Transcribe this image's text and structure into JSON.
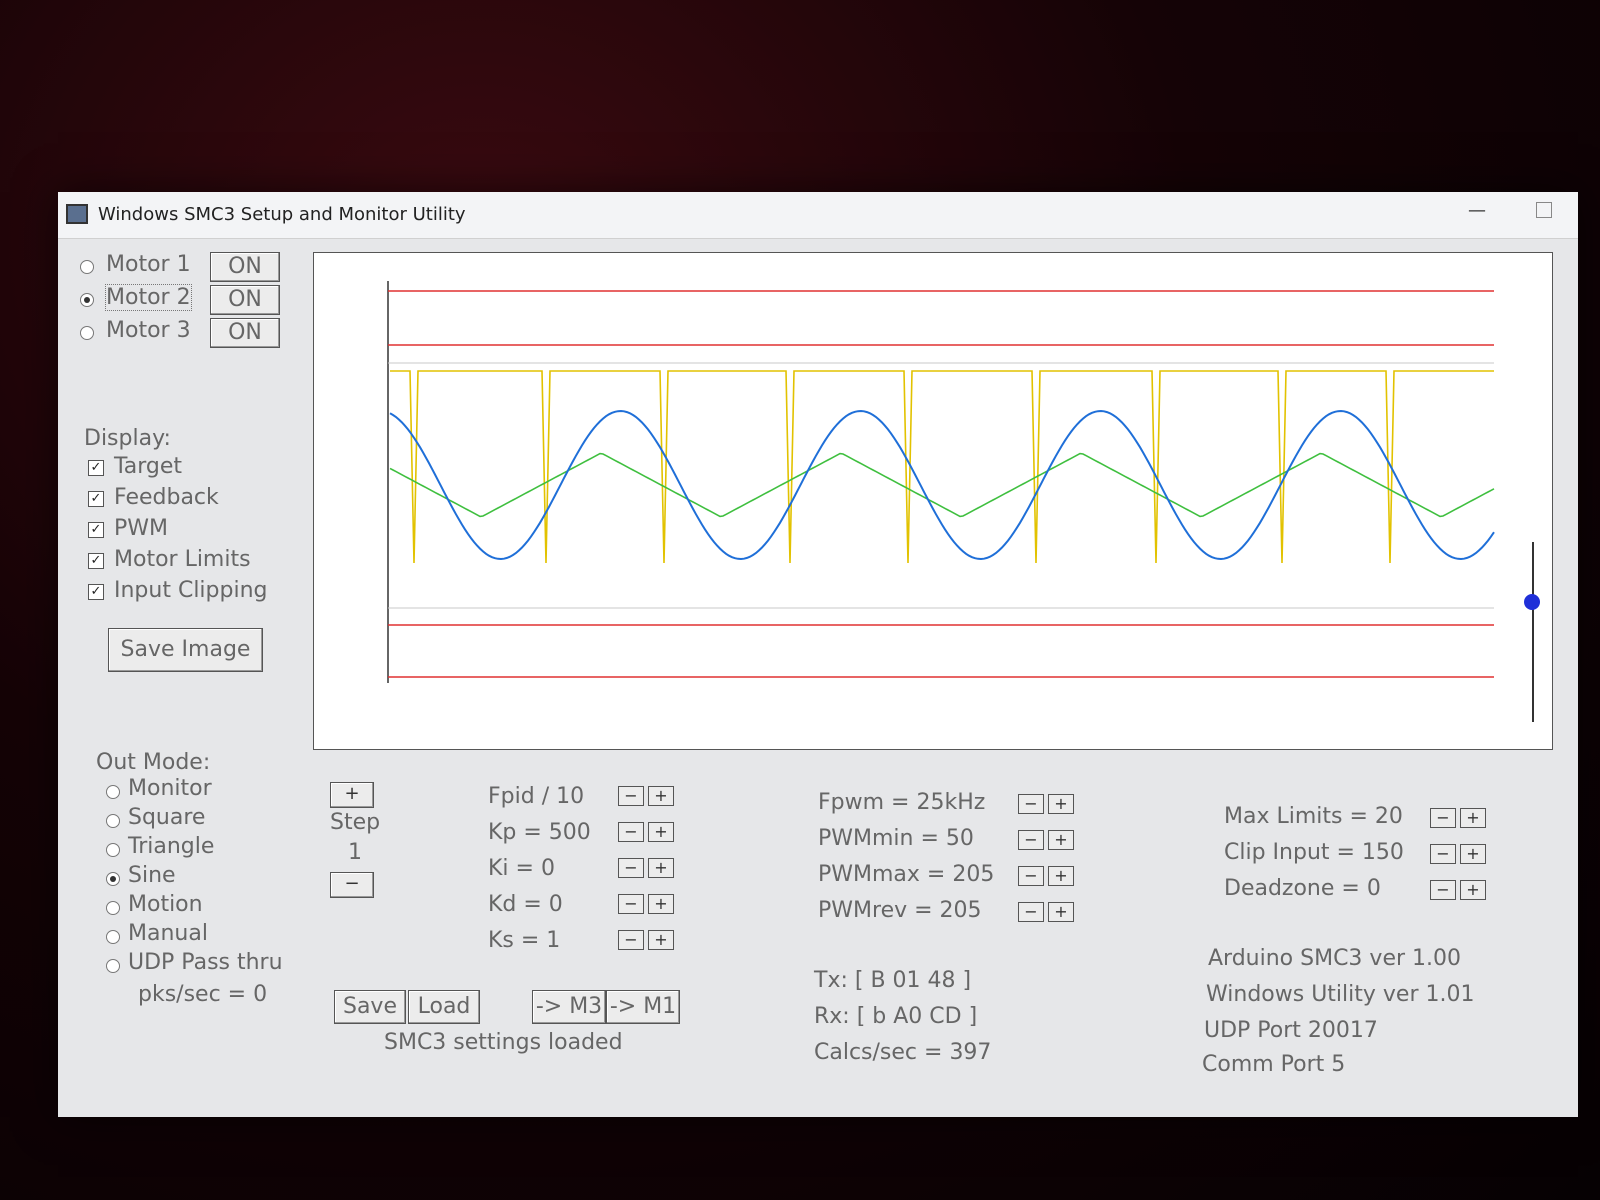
{
  "window": {
    "title": "Windows SMC3 Setup and Monitor Utility"
  },
  "motors": [
    {
      "label": "Motor 1",
      "state": "ON",
      "selected": false
    },
    {
      "label": "Motor 2",
      "state": "ON",
      "selected": true
    },
    {
      "label": "Motor 3",
      "state": "ON",
      "selected": false
    }
  ],
  "display": {
    "heading": "Display:",
    "options": [
      {
        "label": "Target",
        "checked": true
      },
      {
        "label": "Feedback",
        "checked": true
      },
      {
        "label": "PWM",
        "checked": true
      },
      {
        "label": "Motor Limits",
        "checked": true
      },
      {
        "label": "Input Clipping",
        "checked": true
      }
    ],
    "save_image": "Save Image"
  },
  "out_mode": {
    "heading": "Out Mode:",
    "options": [
      {
        "label": "Monitor",
        "selected": false
      },
      {
        "label": "Square",
        "selected": false
      },
      {
        "label": "Triangle",
        "selected": false
      },
      {
        "label": "Sine",
        "selected": true
      },
      {
        "label": "Motion",
        "selected": false
      },
      {
        "label": "Manual",
        "selected": false
      },
      {
        "label": "UDP Pass thru",
        "selected": false
      }
    ],
    "pks": "pks/sec = 0"
  },
  "step": {
    "plus": "+",
    "label": "Step",
    "value": "1",
    "minus": "−"
  },
  "pid": [
    "Fpid / 10",
    "Kp = 500",
    "Ki = 0",
    "Kd = 0",
    "Ks = 1"
  ],
  "pwm": [
    "Fpwm = 25kHz",
    "PWMmin = 50",
    "PWMmax = 205",
    "PWMrev = 205"
  ],
  "limits": [
    "Max Limits = 20",
    "Clip Input = 150",
    "Deadzone = 0"
  ],
  "actions": {
    "save": "Save",
    "load": "Load",
    "m3": "-> M3",
    "m1": "-> M1",
    "status": "SMC3 settings loaded"
  },
  "comms": {
    "tx": "Tx: [ B 01 48 ]",
    "rx": "Rx: [ b A0 CD ]",
    "calcs": "Calcs/sec = 397"
  },
  "info": [
    "Arduino SMC3 ver 1.00",
    "Windows Utility ver 1.01",
    "UDP Port 20017",
    "Comm Port 5"
  ],
  "pm_labels": {
    "minus": "−",
    "plus": "+"
  },
  "colors": {
    "target": "#1f6fd8",
    "feedback": "#3fbf3f",
    "pwm": "#e2c200",
    "limits": "#e03030",
    "clip": "#c8c8c8"
  }
}
